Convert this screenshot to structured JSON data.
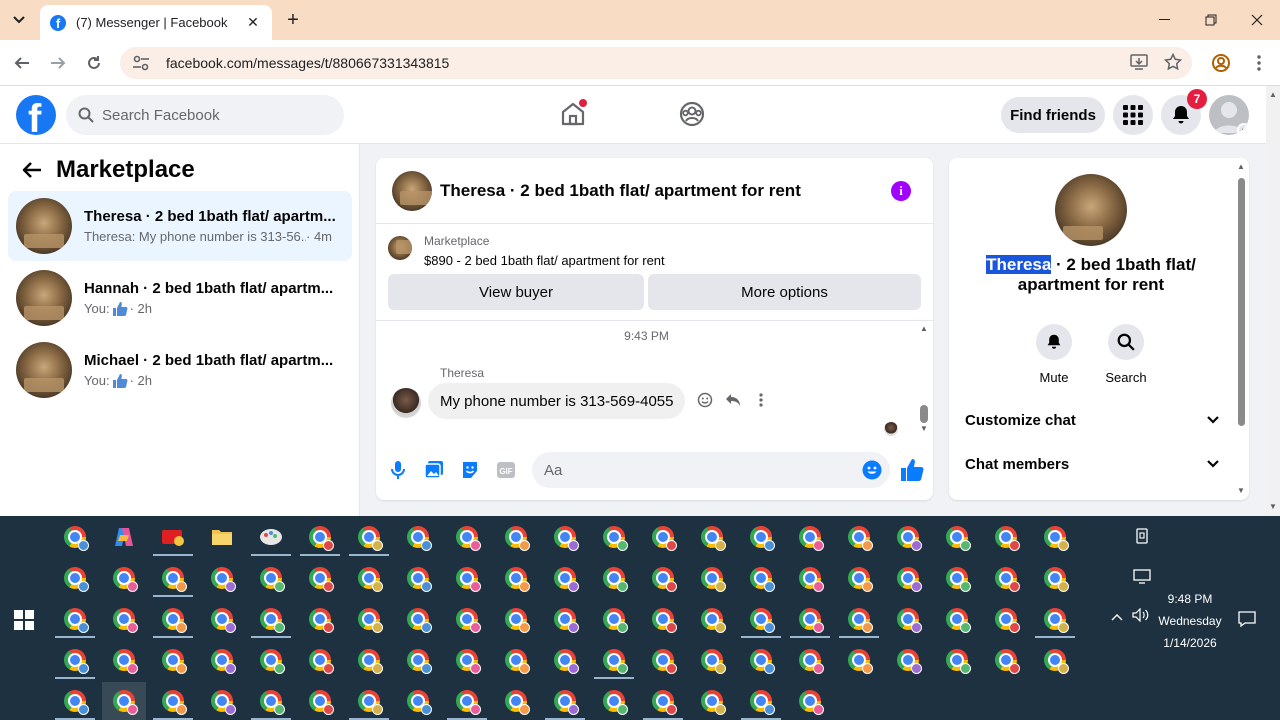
{
  "browser": {
    "tab_title": "(7) Messenger | Facebook",
    "url": "facebook.com/messages/t/880667331343815"
  },
  "fb_header": {
    "search_placeholder": "Search Facebook",
    "find_friends_label": "Find friends",
    "notification_count": "7"
  },
  "left_panel": {
    "title": "Marketplace",
    "conversations": [
      {
        "name": "Theresa · 2 bed 1bath flat/ apartm...",
        "preview": "Theresa: My phone number is 313-56...",
        "time": "· 4m",
        "active": true
      },
      {
        "name": "Hannah · 2 bed 1bath flat/ apartm...",
        "preview": "You:",
        "time": "· 2h",
        "active": false
      },
      {
        "name": "Michael · 2 bed 1bath flat/ apartm...",
        "preview": "You:",
        "time": "· 2h",
        "active": false
      }
    ]
  },
  "chat": {
    "header_title": "Theresa · 2 bed 1bath flat/ apartment for rent",
    "marketplace_label": "Marketplace",
    "listing_title": "$890 - 2 bed 1bath flat/ apartment for rent",
    "view_buyer_label": "View buyer",
    "more_options_label": "More options",
    "timestamp": "9:43 PM",
    "sender_name": "Theresa",
    "message_text": "My phone number is 313-569-4055",
    "composer_placeholder": "Aa"
  },
  "right_panel": {
    "title_highlight": "Theresa",
    "title_rest": " · 2 bed 1bath flat/ apartment for rent",
    "mute_label": "Mute",
    "search_label": "Search",
    "customize_chat_label": "Customize chat",
    "chat_members_label": "Chat members"
  },
  "taskbar": {
    "time": "9:48 PM",
    "day": "Wednesday",
    "date": "1/14/2026"
  },
  "colors": {
    "facebook_blue": "#1877f2",
    "info_purple": "#a100ff",
    "badge_red": "#e41e3f",
    "taskbar_bg": "#1e3140"
  }
}
